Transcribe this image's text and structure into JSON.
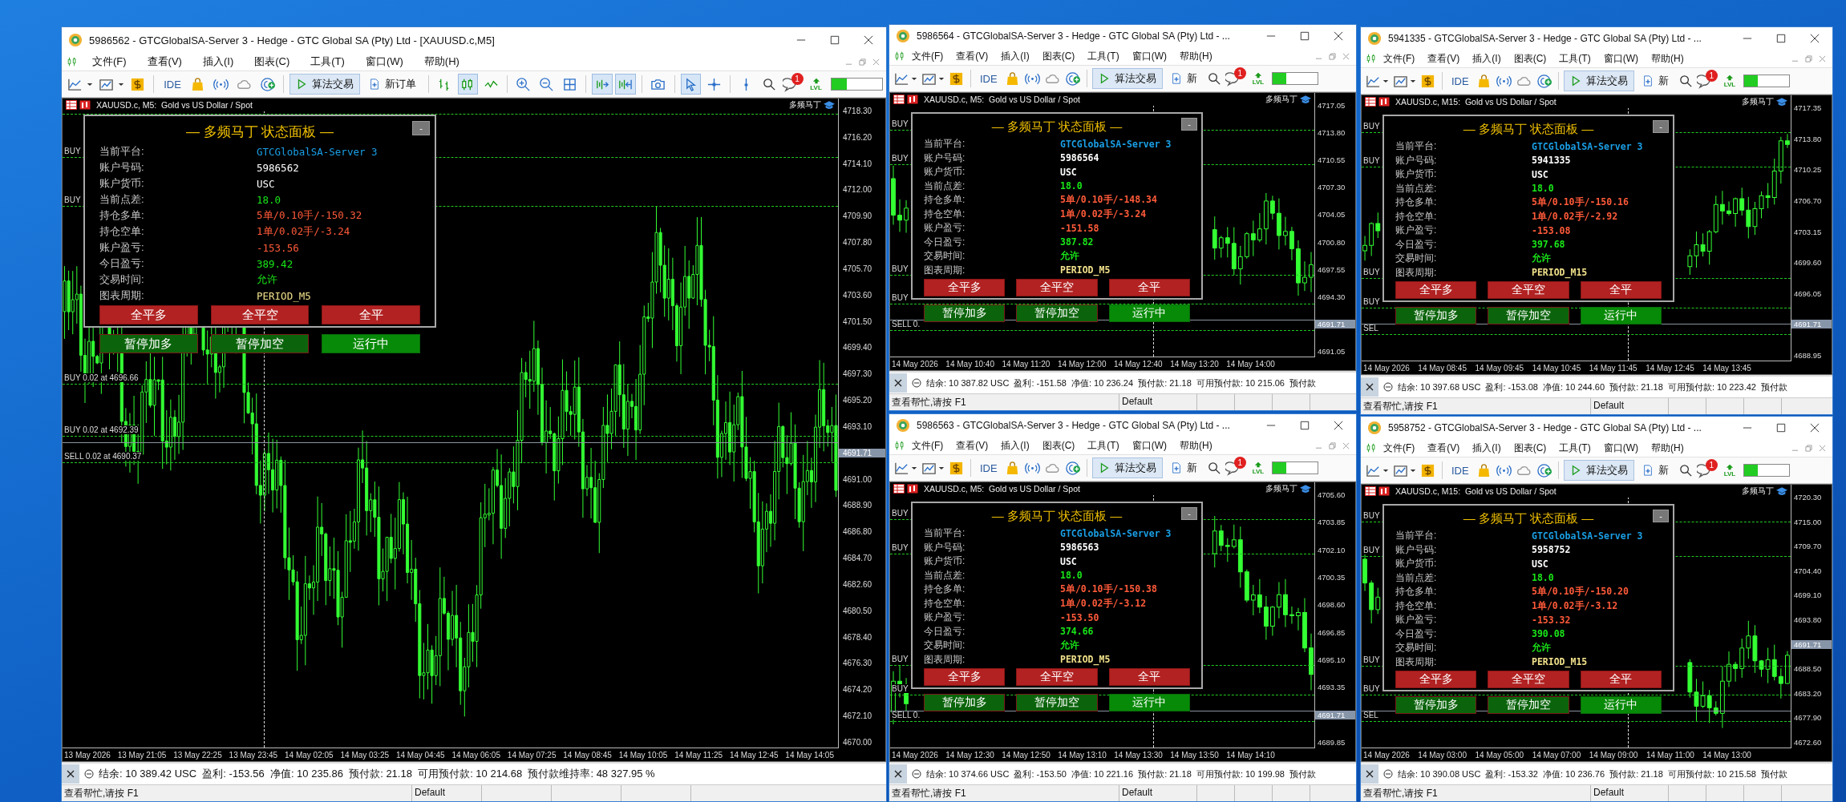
{
  "windows": [
    {
      "title": "5986562 - GTCGlobalSA-Server 3 - Hedge - GTC Global SA (Pty) Ltd - [XAUUSD.c,M5]",
      "compact": false,
      "menu": [
        "文件(F)",
        "查看(V)",
        "插入(I)",
        "图表(C)",
        "工具(T)",
        "窗口(W)",
        "帮助(H)"
      ],
      "toolbar": {
        "ide": "IDE",
        "algo_trading": "算法交易",
        "algo_on": true,
        "new_order": "新订单",
        "badge": "1",
        "lvl": "LVL",
        "candles_on": true,
        "autoscroll_on": true,
        "chart_shift_on": true,
        "cursor_on": true
      },
      "chart": {
        "symbol": "XAUUSD.c, M5:  Gold vs US Dollar / Spot",
        "ea_name": "多频马丁",
        "price_labels": [
          {
            "text": "4718.30",
            "current": false
          },
          {
            "text": "4716.20",
            "current": false
          },
          {
            "text": "4714.10",
            "current": false
          },
          {
            "text": "4712.00",
            "current": false
          },
          {
            "text": "4709.90",
            "current": false
          },
          {
            "text": "4707.80",
            "current": false
          },
          {
            "text": "4705.70",
            "current": false
          },
          {
            "text": "4703.60",
            "current": false
          },
          {
            "text": "4701.50",
            "current": false
          },
          {
            "text": "4699.40",
            "current": false
          },
          {
            "text": "4697.30",
            "current": false
          },
          {
            "text": "4695.20",
            "current": false
          },
          {
            "text": "4693.10",
            "current": false
          },
          {
            "text": "4691.71",
            "current": true
          },
          {
            "text": "4691.00",
            "current": false
          },
          {
            "text": "4688.90",
            "current": false
          },
          {
            "text": "4686.80",
            "current": false
          },
          {
            "text": "4684.70",
            "current": false
          },
          {
            "text": "4682.60",
            "current": false
          },
          {
            "text": "4680.50",
            "current": false
          },
          {
            "text": "4678.40",
            "current": false
          },
          {
            "text": "4676.30",
            "current": false
          },
          {
            "text": "4674.20",
            "current": false
          },
          {
            "text": "4672.10",
            "current": false
          },
          {
            "text": "4670.00",
            "current": false
          }
        ],
        "time_labels": [
          "13 May 2026",
          "13 May 21:05",
          "13 May 22:25",
          "13 May 23:45",
          "14 May 02:05",
          "14 May 03:25",
          "14 May 04:45",
          "14 May 06:05",
          "14 May 07:25",
          "14 May 08:45",
          "14 May 10:05",
          "14 May 11:25",
          "14 May 12:45",
          "14 May 14:05"
        ],
        "order_lines": [
          {
            "label": "BUY"
          },
          {
            "label": "BUY"
          },
          {
            "label": "BUY 0.02 at 4696.66"
          },
          {
            "label": "BUY 0.02 at 4692.39"
          },
          {
            "label": "SELL 0.02 at 4690.37"
          }
        ]
      },
      "panel": {
        "title": "— 多频马丁 状态面板 —",
        "minimize": "-",
        "rows": [
          {
            "label": "当前平台:",
            "value": "GTCGlobalSA-Server 3",
            "color": "#1a9fe6"
          },
          {
            "label": "账户号码:",
            "value": "5986562",
            "color": "#ffffff"
          },
          {
            "label": "账户货币:",
            "value": "USC",
            "color": "#ffffff"
          },
          {
            "label": "当前点差:",
            "value": "18.0",
            "color": "#19e619"
          },
          {
            "label": "持仓多单:",
            "value": "5单/0.10手/-150.32",
            "color": "#ff5a3a"
          },
          {
            "label": "持仓空单:",
            "value": "1单/0.02手/-3.24",
            "color": "#ff5a3a"
          },
          {
            "label": "账户盈亏:",
            "value": "-153.56",
            "color": "#ff5a3a"
          },
          {
            "label": "今日盈亏:",
            "value": "389.42",
            "color": "#19e619"
          },
          {
            "label": "交易时间:",
            "value": "允许",
            "color": "#19e619"
          },
          {
            "label": "图表周期:",
            "value": "PERIOD_M5",
            "color": "#f0e08a"
          }
        ],
        "action_buttons": [
          {
            "label": "全平多",
            "kind": "close"
          },
          {
            "label": "全平空",
            "kind": "close"
          },
          {
            "label": "全平",
            "kind": "close"
          }
        ],
        "control_buttons": [
          {
            "label": "暂停加多",
            "kind": "pause"
          },
          {
            "label": "暂停加空",
            "kind": "pause"
          },
          {
            "label": "运行中",
            "kind": "running"
          }
        ]
      },
      "summary": "结余: 10 389.42 USC  盈利: -153.56  净值: 10 235.86  预付款: 21.18  可用预付款: 10 214.68  预付款维持率: 48 327.95 %",
      "status": {
        "help": "查看帮忙,请按 F1",
        "profile": "Default"
      }
    },
    {
      "title": "5986564 - GTCGlobalSA-Server 3 - Hedge - GTC Global SA (Pty) Ltd - ...",
      "compact": true,
      "menu": [
        "文件(F)",
        "查看(V)",
        "插入(I)",
        "图表(C)",
        "工具(T)",
        "窗口(W)",
        "帮助(H)"
      ],
      "toolbar": {
        "ide": "IDE",
        "algo_trading": "算法交易",
        "algo_on": true,
        "new_order": "新",
        "badge": "1",
        "lvl": "LVL"
      },
      "chart": {
        "symbol": "XAUUSD.c, M5:  Gold vs US Dollar / Spot",
        "ea_name": "多频马丁",
        "price_labels": [
          {
            "text": "4717.05",
            "current": false
          },
          {
            "text": "4713.80",
            "current": false
          },
          {
            "text": "4710.55",
            "current": false
          },
          {
            "text": "4707.30",
            "current": false
          },
          {
            "text": "4704.05",
            "current": false
          },
          {
            "text": "4700.80",
            "current": false
          },
          {
            "text": "4697.55",
            "current": false
          },
          {
            "text": "4694.30",
            "current": false
          },
          {
            "text": "4691.71",
            "current": true
          },
          {
            "text": "4691.05",
            "current": false
          }
        ],
        "time_labels": [
          "14 May 2026",
          "14 May 10:40",
          "14 May 11:20",
          "14 May 12:00",
          "14 May 12:40",
          "14 May 13:20",
          "14 May 14:00"
        ],
        "order_lines": [
          {
            "label": "BUY"
          },
          {
            "label": "BUY"
          },
          {
            "label": "BUY"
          },
          {
            "label": "BUY"
          },
          {
            "label": "SELL 0."
          }
        ]
      },
      "panel": {
        "title": "— 多频马丁 状态面板 —",
        "minimize": "-",
        "rows": [
          {
            "label": "当前平台:",
            "value": "GTCGlobalSA-Server 3",
            "color": "#1a9fe6"
          },
          {
            "label": "账户号码:",
            "value": "5986564",
            "color": "#ffffff"
          },
          {
            "label": "账户货币:",
            "value": "USC",
            "color": "#ffffff"
          },
          {
            "label": "当前点差:",
            "value": "18.0",
            "color": "#19e619"
          },
          {
            "label": "持仓多单:",
            "value": "5单/0.10手/-148.34",
            "color": "#ff5a3a"
          },
          {
            "label": "持仓空单:",
            "value": "1单/0.02手/-3.24",
            "color": "#ff5a3a"
          },
          {
            "label": "账户盈亏:",
            "value": "-151.58",
            "color": "#ff5a3a"
          },
          {
            "label": "今日盈亏:",
            "value": "387.82",
            "color": "#19e619"
          },
          {
            "label": "交易时间:",
            "value": "允许",
            "color": "#19e619"
          },
          {
            "label": "图表周期:",
            "value": "PERIOD_M5",
            "color": "#f0e08a"
          }
        ],
        "action_buttons": [
          {
            "label": "全平多",
            "kind": "close"
          },
          {
            "label": "全平空",
            "kind": "close"
          },
          {
            "label": "全平",
            "kind": "close"
          }
        ],
        "control_buttons": [
          {
            "label": "暂停加多",
            "kind": "pause"
          },
          {
            "label": "暂停加空",
            "kind": "pause"
          },
          {
            "label": "运行中",
            "kind": "running"
          }
        ]
      },
      "summary": "结余: 10 387.82 USC  盈利: -151.58  净值: 10 236.24  预付款: 21.18  可用预付款: 10 215.06  预付款",
      "status": {
        "help": "查看帮忙,请按 F1",
        "profile": "Default"
      }
    },
    {
      "title": "5941335 - GTCGlobalSA-Server 3 - Hedge - GTC Global SA (Pty) Ltd - ...",
      "compact": true,
      "menu": [
        "文件(F)",
        "查看(V)",
        "插入(I)",
        "图表(C)",
        "工具(T)",
        "窗口(W)",
        "帮助(H)"
      ],
      "toolbar": {
        "ide": "IDE",
        "algo_trading": "算法交易",
        "algo_on": true,
        "new_order": "新",
        "badge": "1",
        "lvl": "LVL"
      },
      "chart": {
        "symbol": "XAUUSD.c, M15:  Gold vs US Dollar / Spot",
        "ea_name": "多频马丁",
        "price_labels": [
          {
            "text": "4717.35",
            "current": false
          },
          {
            "text": "4713.80",
            "current": false
          },
          {
            "text": "4710.25",
            "current": false
          },
          {
            "text": "4706.70",
            "current": false
          },
          {
            "text": "4703.15",
            "current": false
          },
          {
            "text": "4699.60",
            "current": false
          },
          {
            "text": "4696.05",
            "current": false
          },
          {
            "text": "4691.71",
            "current": true
          },
          {
            "text": "4688.95",
            "current": false
          }
        ],
        "time_labels": [
          "14 May 2026",
          "14 May 08:45",
          "14 May 09:45",
          "14 May 10:45",
          "14 May 11:45",
          "14 May 12:45",
          "14 May 13:45"
        ],
        "order_lines": [
          {
            "label": "BUY"
          },
          {
            "label": "BUY"
          },
          {
            "label": "BUY"
          },
          {
            "label": "BUY"
          },
          {
            "label": "SEL"
          }
        ]
      },
      "panel": {
        "title": "— 多频马丁 状态面板 —",
        "minimize": "-",
        "rows": [
          {
            "label": "当前平台:",
            "value": "GTCGlobalSA-Server 3",
            "color": "#1a9fe6"
          },
          {
            "label": "账户号码:",
            "value": "5941335",
            "color": "#ffffff"
          },
          {
            "label": "账户货币:",
            "value": "USC",
            "color": "#ffffff"
          },
          {
            "label": "当前点差:",
            "value": "18.0",
            "color": "#19e619"
          },
          {
            "label": "持仓多单:",
            "value": "5单/0.10手/-150.16",
            "color": "#ff5a3a"
          },
          {
            "label": "持仓空单:",
            "value": "1单/0.02手/-2.92",
            "color": "#ff5a3a"
          },
          {
            "label": "账户盈亏:",
            "value": "-153.08",
            "color": "#ff5a3a"
          },
          {
            "label": "今日盈亏:",
            "value": "397.68",
            "color": "#19e619"
          },
          {
            "label": "交易时间:",
            "value": "允许",
            "color": "#19e619"
          },
          {
            "label": "图表周期:",
            "value": "PERIOD_M15",
            "color": "#f0e08a"
          }
        ],
        "action_buttons": [
          {
            "label": "全平多",
            "kind": "close"
          },
          {
            "label": "全平空",
            "kind": "close"
          },
          {
            "label": "全平",
            "kind": "close"
          }
        ],
        "control_buttons": [
          {
            "label": "暂停加多",
            "kind": "pause"
          },
          {
            "label": "暂停加空",
            "kind": "pause"
          },
          {
            "label": "运行中",
            "kind": "running"
          }
        ]
      },
      "summary": "结余: 10 397.68 USC  盈利: -153.08  净值: 10 244.60  预付款: 21.18  可用预付款: 10 223.42  预付款",
      "status": {
        "help": "查看帮忙,请按 F1",
        "profile": "Default"
      }
    },
    {
      "title": "5986563 - GTCGlobalSA-Server 3 - Hedge - GTC Global SA (Pty) Ltd - ...",
      "compact": true,
      "menu": [
        "文件(F)",
        "查看(V)",
        "插入(I)",
        "图表(C)",
        "工具(T)",
        "窗口(W)",
        "帮助(H)"
      ],
      "toolbar": {
        "ide": "IDE",
        "algo_trading": "算法交易",
        "algo_on": true,
        "new_order": "新",
        "badge": "1",
        "lvl": "LVL"
      },
      "chart": {
        "symbol": "XAUUSD.c, M5:  Gold vs US Dollar / Spot",
        "ea_name": "多频马丁",
        "price_labels": [
          {
            "text": "4705.60",
            "current": false
          },
          {
            "text": "4703.85",
            "current": false
          },
          {
            "text": "4702.10",
            "current": false
          },
          {
            "text": "4700.35",
            "current": false
          },
          {
            "text": "4698.60",
            "current": false
          },
          {
            "text": "4696.85",
            "current": false
          },
          {
            "text": "4695.10",
            "current": false
          },
          {
            "text": "4693.35",
            "current": false
          },
          {
            "text": "4691.71",
            "current": true
          },
          {
            "text": "4689.85",
            "current": false
          }
        ],
        "time_labels": [
          "14 May 2026",
          "14 May 12:30",
          "14 May 12:50",
          "14 May 13:10",
          "14 May 13:30",
          "14 May 13:50",
          "14 May 14:10"
        ],
        "order_lines": [
          {
            "label": "BUY"
          },
          {
            "label": "BUY"
          },
          {
            "label": "BUY"
          },
          {
            "label": "BUY"
          },
          {
            "label": "SELL 0."
          }
        ]
      },
      "panel": {
        "title": "— 多频马丁 状态面板 —",
        "minimize": "-",
        "rows": [
          {
            "label": "当前平台:",
            "value": "GTCGlobalSA-Server 3",
            "color": "#1a9fe6"
          },
          {
            "label": "账户号码:",
            "value": "5986563",
            "color": "#ffffff"
          },
          {
            "label": "账户货币:",
            "value": "USC",
            "color": "#ffffff"
          },
          {
            "label": "当前点差:",
            "value": "18.0",
            "color": "#19e619"
          },
          {
            "label": "持仓多单:",
            "value": "5单/0.10手/-150.38",
            "color": "#ff5a3a"
          },
          {
            "label": "持仓空单:",
            "value": "1单/0.02手/-3.12",
            "color": "#ff5a3a"
          },
          {
            "label": "账户盈亏:",
            "value": "-153.50",
            "color": "#ff5a3a"
          },
          {
            "label": "今日盈亏:",
            "value": "374.66",
            "color": "#19e619"
          },
          {
            "label": "交易时间:",
            "value": "允许",
            "color": "#19e619"
          },
          {
            "label": "图表周期:",
            "value": "PERIOD_M5",
            "color": "#f0e08a"
          }
        ],
        "action_buttons": [
          {
            "label": "全平多",
            "kind": "close"
          },
          {
            "label": "全平空",
            "kind": "close"
          },
          {
            "label": "全平",
            "kind": "close"
          }
        ],
        "control_buttons": [
          {
            "label": "暂停加多",
            "kind": "pause"
          },
          {
            "label": "暂停加空",
            "kind": "pause"
          },
          {
            "label": "运行中",
            "kind": "running"
          }
        ]
      },
      "summary": "结余: 10 374.66 USC  盈利: -153.50  净值: 10 221.16  预付款: 21.18  可用预付款: 10 199.98  预付款",
      "status": {
        "help": "查看帮忙,请按 F1",
        "profile": "Default"
      }
    },
    {
      "title": "5958752 - GTCGlobalSA-Server 3 - Hedge - GTC Global SA (Pty) Ltd - ...",
      "compact": true,
      "menu": [
        "文件(F)",
        "查看(V)",
        "插入(I)",
        "图表(C)",
        "工具(T)",
        "窗口(W)",
        "帮助(H)"
      ],
      "toolbar": {
        "ide": "IDE",
        "algo_trading": "算法交易",
        "algo_on": true,
        "new_order": "新",
        "badge": "1",
        "lvl": "LVL"
      },
      "chart": {
        "symbol": "XAUUSD.c, M15:  Gold vs US Dollar / Spot",
        "ea_name": "多频马丁",
        "price_labels": [
          {
            "text": "4720.30",
            "current": false
          },
          {
            "text": "4715.00",
            "current": false
          },
          {
            "text": "4709.70",
            "current": false
          },
          {
            "text": "4704.40",
            "current": false
          },
          {
            "text": "4699.10",
            "current": false
          },
          {
            "text": "4693.80",
            "current": false
          },
          {
            "text": "4691.71",
            "current": true
          },
          {
            "text": "4688.50",
            "current": false
          },
          {
            "text": "4683.20",
            "current": false
          },
          {
            "text": "4677.90",
            "current": false
          },
          {
            "text": "4672.60",
            "current": false
          }
        ],
        "time_labels": [
          "14 May 2026",
          "14 May 03:00",
          "14 May 05:00",
          "14 May 07:00",
          "14 May 09:00",
          "14 May 11:00",
          "14 May 13:00"
        ],
        "order_lines": [
          {
            "label": "BUY"
          },
          {
            "label": "BUY"
          },
          {
            "label": "BUY"
          },
          {
            "label": "BUY"
          },
          {
            "label": "SEL"
          }
        ]
      },
      "panel": {
        "title": "— 多频马丁 状态面板 —",
        "minimize": "-",
        "rows": [
          {
            "label": "当前平台:",
            "value": "GTCGlobalSA-Server 3",
            "color": "#1a9fe6"
          },
          {
            "label": "账户号码:",
            "value": "5958752",
            "color": "#ffffff"
          },
          {
            "label": "账户货币:",
            "value": "USC",
            "color": "#ffffff"
          },
          {
            "label": "当前点差:",
            "value": "18.0",
            "color": "#19e619"
          },
          {
            "label": "持仓多单:",
            "value": "5单/0.10手/-150.20",
            "color": "#ff5a3a"
          },
          {
            "label": "持仓空单:",
            "value": "1单/0.02手/-3.12",
            "color": "#ff5a3a"
          },
          {
            "label": "账户盈亏:",
            "value": "-153.32",
            "color": "#ff5a3a"
          },
          {
            "label": "今日盈亏:",
            "value": "390.08",
            "color": "#19e619"
          },
          {
            "label": "交易时间:",
            "value": "允许",
            "color": "#19e619"
          },
          {
            "label": "图表周期:",
            "value": "PERIOD_M15",
            "color": "#f0e08a"
          }
        ],
        "action_buttons": [
          {
            "label": "全平多",
            "kind": "close"
          },
          {
            "label": "全平空",
            "kind": "close"
          },
          {
            "label": "全平",
            "kind": "close"
          }
        ],
        "control_buttons": [
          {
            "label": "暂停加多",
            "kind": "pause"
          },
          {
            "label": "暂停加空",
            "kind": "pause"
          },
          {
            "label": "运行中",
            "kind": "running"
          }
        ]
      },
      "summary": "结余: 10 390.08 USC  盈利: -153.32  净值: 10 236.76  预付款: 21.18  可用预付款: 10 215.58  预付款",
      "status": {
        "help": "查看帮忙,请按 F1",
        "profile": "Default"
      }
    }
  ]
}
